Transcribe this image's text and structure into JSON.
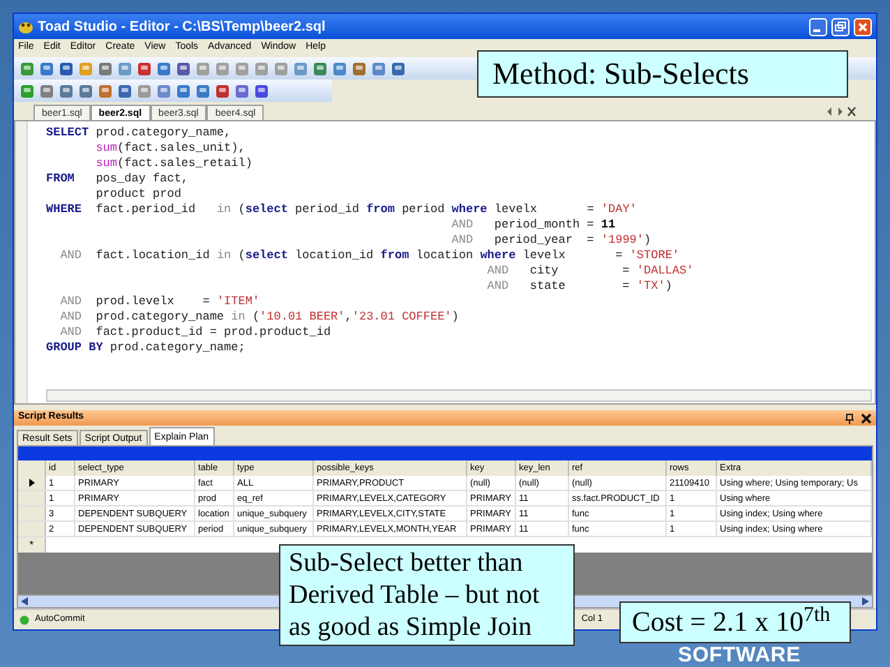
{
  "window": {
    "title": "Toad Studio - Editor - C:\\BS\\Temp\\beer2.sql"
  },
  "menu": [
    "File",
    "Edit",
    "Editor",
    "Create",
    "View",
    "Tools",
    "Advanced",
    "Window",
    "Help"
  ],
  "editor_tabs": [
    {
      "label": "beer1.sql",
      "selected": false
    },
    {
      "label": "beer2.sql",
      "selected": true
    },
    {
      "label": "beer3.sql",
      "selected": false
    },
    {
      "label": "beer4.sql",
      "selected": false
    }
  ],
  "sql_lines": [
    [
      {
        "kind": "kw",
        "text": "SELECT"
      },
      {
        "kind": "plain",
        "text": " prod.category_name,"
      }
    ],
    [
      {
        "kind": "func",
        "text": "       sum"
      },
      {
        "kind": "plain",
        "text": "(fact.sales_unit),"
      }
    ],
    [
      {
        "kind": "func",
        "text": "       sum"
      },
      {
        "kind": "plain",
        "text": "(fact.sales_retail)"
      }
    ],
    [
      {
        "kind": "kw",
        "text": "FROM"
      },
      {
        "kind": "plain",
        "text": "   pos_day fact,"
      }
    ],
    [
      {
        "kind": "plain",
        "text": "       product prod"
      }
    ],
    [
      {
        "kind": "kw",
        "text": "WHERE"
      },
      {
        "kind": "plain",
        "text": "  fact.period_id   "
      },
      {
        "kind": "op",
        "text": "in"
      },
      {
        "kind": "plain",
        "text": " ("
      },
      {
        "kind": "kw",
        "text": "select"
      },
      {
        "kind": "plain",
        "text": " period_id "
      },
      {
        "kind": "kw",
        "text": "from"
      },
      {
        "kind": "plain",
        "text": " period "
      },
      {
        "kind": "kw",
        "text": "where"
      },
      {
        "kind": "plain",
        "text": " levelx       = "
      },
      {
        "kind": "str",
        "text": "'DAY'"
      }
    ],
    [
      {
        "kind": "op",
        "text": "                                                         AND"
      },
      {
        "kind": "plain",
        "text": "   period_month = "
      },
      {
        "kind": "num",
        "text": "11"
      }
    ],
    [
      {
        "kind": "op",
        "text": "                                                         AND"
      },
      {
        "kind": "plain",
        "text": "   period_year  = "
      },
      {
        "kind": "str",
        "text": "'1999'"
      },
      {
        "kind": "plain",
        "text": ")"
      }
    ],
    [
      {
        "kind": "op",
        "text": "  AND"
      },
      {
        "kind": "plain",
        "text": "  fact.location_id "
      },
      {
        "kind": "op",
        "text": "in"
      },
      {
        "kind": "plain",
        "text": " ("
      },
      {
        "kind": "kw",
        "text": "select"
      },
      {
        "kind": "plain",
        "text": " location_id "
      },
      {
        "kind": "kw",
        "text": "from"
      },
      {
        "kind": "plain",
        "text": " location "
      },
      {
        "kind": "kw",
        "text": "where"
      },
      {
        "kind": "plain",
        "text": " levelx       = "
      },
      {
        "kind": "str",
        "text": "'STORE'"
      }
    ],
    [
      {
        "kind": "op",
        "text": "                                                              AND"
      },
      {
        "kind": "plain",
        "text": "   city         = "
      },
      {
        "kind": "str",
        "text": "'DALLAS'"
      }
    ],
    [
      {
        "kind": "op",
        "text": "                                                              AND"
      },
      {
        "kind": "plain",
        "text": "   state        = "
      },
      {
        "kind": "str",
        "text": "'TX'"
      },
      {
        "kind": "plain",
        "text": ")"
      }
    ],
    [
      {
        "kind": "op",
        "text": "  AND"
      },
      {
        "kind": "plain",
        "text": "  prod.levelx    = "
      },
      {
        "kind": "str",
        "text": "'ITEM'"
      }
    ],
    [
      {
        "kind": "op",
        "text": "  AND"
      },
      {
        "kind": "plain",
        "text": "  prod.category_name "
      },
      {
        "kind": "op",
        "text": "in"
      },
      {
        "kind": "plain",
        "text": " ("
      },
      {
        "kind": "str",
        "text": "'10.01 BEER'"
      },
      {
        "kind": "plain",
        "text": ","
      },
      {
        "kind": "str",
        "text": "'23.01 COFFEE'"
      },
      {
        "kind": "plain",
        "text": ")"
      }
    ],
    [
      {
        "kind": "op",
        "text": "  AND"
      },
      {
        "kind": "plain",
        "text": "  fact.product_id = prod.product_id"
      }
    ],
    [
      {
        "kind": "kw",
        "text": "GROUP BY"
      },
      {
        "kind": "plain",
        "text": " prod.category_name;"
      }
    ]
  ],
  "results_panel": {
    "title": "Script Results",
    "tabs": [
      {
        "label": "Result Sets",
        "selected": false
      },
      {
        "label": "Script Output",
        "selected": false
      },
      {
        "label": "Explain Plan",
        "selected": true
      }
    ],
    "columns": [
      "id",
      "select_type",
      "table",
      "type",
      "possible_keys",
      "key",
      "key_len",
      "ref",
      "rows",
      "Extra"
    ],
    "rows": [
      {
        "current": true,
        "cells": [
          "1",
          "PRIMARY",
          "fact",
          "ALL",
          "PRIMARY,PRODUCT",
          "(null)",
          "(null)",
          "(null)",
          "21109410",
          "Using where; Using temporary; Us"
        ]
      },
      {
        "current": false,
        "cells": [
          "1",
          "PRIMARY",
          "prod",
          "eq_ref",
          "PRIMARY,LEVELX,CATEGORY",
          "PRIMARY",
          "11",
          "ss.fact.PRODUCT_ID",
          "1",
          "Using where"
        ]
      },
      {
        "current": false,
        "cells": [
          "3",
          "DEPENDENT SUBQUERY",
          "location",
          "unique_subquery",
          "PRIMARY,LEVELX,CITY,STATE",
          "PRIMARY",
          "11",
          "func",
          "1",
          "Using index; Using where"
        ]
      },
      {
        "current": false,
        "cells": [
          "2",
          "DEPENDENT SUBQUERY",
          "period",
          "unique_subquery",
          "PRIMARY,LEVELX,MONTH,YEAR",
          "PRIMARY",
          "11",
          "func",
          "1",
          "Using index; Using where"
        ]
      }
    ],
    "new_row_marker": "*"
  },
  "status_bar": {
    "autocommit": "AutoCommit",
    "position": "Col 1"
  },
  "callouts": [
    {
      "kind": "method",
      "text": "Method: Sub-Selects"
    },
    {
      "kind": "note",
      "text": "Sub-Select better than Derived Table – but not as good as Simple Join"
    },
    {
      "kind": "cost",
      "text": "Cost = 2.1 x 10$^{7th}$"
    }
  ],
  "logo": "SOFTWARE"
}
